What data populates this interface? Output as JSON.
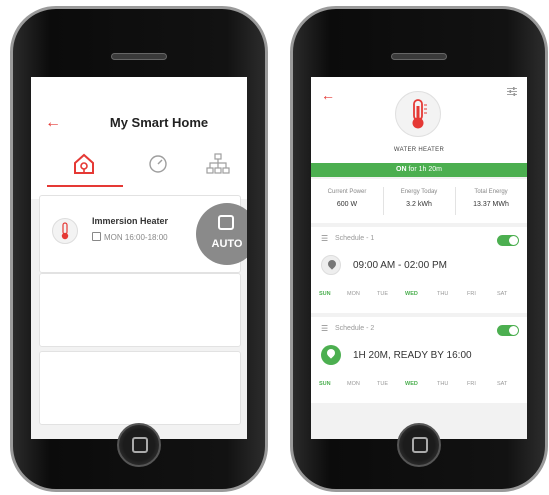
{
  "left_phone": {
    "title": "My Smart Home",
    "tabs": [
      "home-tab",
      "gauge-tab",
      "network-tab"
    ],
    "device": {
      "name": "Immersion Heater",
      "schedule": "MON 16:00-18:00",
      "auto_label": "AUTO"
    }
  },
  "right_phone": {
    "device_title": "WATER HEATER",
    "status_on": "ON",
    "status_duration": "for 1h 20m",
    "stats": [
      {
        "label": "Current Power",
        "value": "600 W"
      },
      {
        "label": "Energy Today",
        "value": "3.2 kWh"
      },
      {
        "label": "Total Energy",
        "value": "13.37 MWh"
      }
    ],
    "schedules": [
      {
        "title": "Schedule - 1",
        "time": "09:00 AM - 02:00 PM",
        "enabled": true,
        "highlight": false
      },
      {
        "title": "Schedule - 2",
        "time": "1H 20M, READY BY 16:00",
        "enabled": true,
        "highlight": true
      }
    ],
    "days": [
      "SUN",
      "MON",
      "TUE",
      "WED",
      "THU",
      "FRI",
      "SAT"
    ],
    "active_days": [
      "SUN",
      "WED"
    ]
  },
  "colors": {
    "accent_red": "#e53935",
    "accent_green": "#4caf50",
    "auto_grey": "#8a8a8a"
  }
}
